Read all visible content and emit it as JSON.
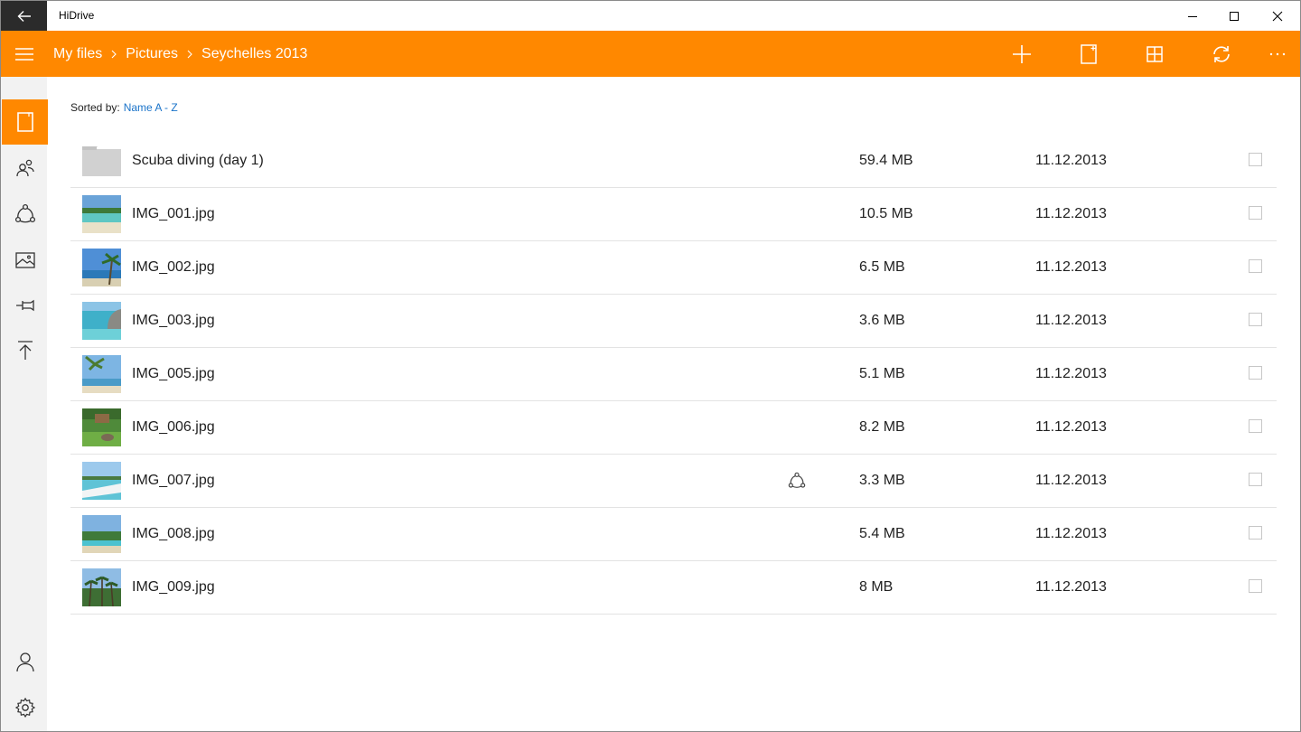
{
  "window": {
    "title": "HiDrive"
  },
  "breadcrumb": [
    "My files",
    "Pictures",
    "Seychelles 2013"
  ],
  "toolbar": {
    "icons": [
      "plus-icon",
      "new-folder-icon",
      "grid-view-icon",
      "refresh-icon",
      "more-icon"
    ]
  },
  "sidebar": {
    "top_items": [
      "my-files-icon",
      "shared-icon",
      "share-icon",
      "pictures-icon",
      "pinned-icon",
      "upload-icon"
    ],
    "bottom_items": [
      "account-icon",
      "settings-icon"
    ]
  },
  "sort": {
    "label": "Sorted by:",
    "value": "Name A - Z"
  },
  "files": [
    {
      "name": "Scuba diving (day 1)",
      "size": "59.4 MB",
      "date": "11.12.2013",
      "type": "folder"
    },
    {
      "name": "IMG_001.jpg",
      "size": "10.5 MB",
      "date": "11.12.2013",
      "type": "image"
    },
    {
      "name": "IMG_002.jpg",
      "size": "6.5 MB",
      "date": "11.12.2013",
      "type": "image"
    },
    {
      "name": "IMG_003.jpg",
      "size": "3.6 MB",
      "date": "11.12.2013",
      "type": "image"
    },
    {
      "name": "IMG_005.jpg",
      "size": "5.1 MB",
      "date": "11.12.2013",
      "type": "image"
    },
    {
      "name": "IMG_006.jpg",
      "size": "8.2 MB",
      "date": "11.12.2013",
      "type": "image"
    },
    {
      "name": "IMG_007.jpg",
      "size": "3.3 MB",
      "date": "11.12.2013",
      "type": "image",
      "shared": true
    },
    {
      "name": "IMG_008.jpg",
      "size": "5.4 MB",
      "date": "11.12.2013",
      "type": "image"
    },
    {
      "name": "IMG_009.jpg",
      "size": "8 MB",
      "date": "11.12.2013",
      "type": "image"
    }
  ],
  "colors": {
    "accent": "#ff8800",
    "link": "#1a73c9"
  }
}
